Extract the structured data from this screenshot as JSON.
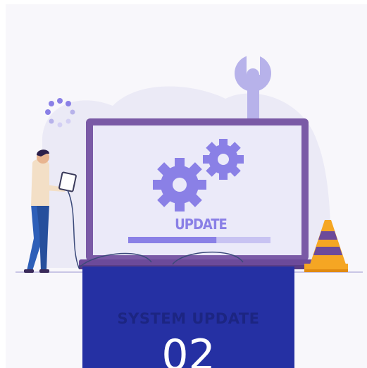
{
  "illustration": {
    "screen_label": "UPDATE",
    "progress_fraction": 0.62,
    "colors": {
      "laptop_frame": "#7a5aa6",
      "screen": "#ebeaf9",
      "gear": "#8a80e6",
      "progress_fill": "#8a80e6",
      "progress_track": "#c8c3f2",
      "blob": "#ebeaf6",
      "wrench": "#b7b2ea",
      "cone_stripe": "#6c4a9a",
      "cone_orange": "#f5a623"
    }
  },
  "panel": {
    "title": "SYSTEM UPDATE",
    "number": "02",
    "background": "#2530a3"
  }
}
